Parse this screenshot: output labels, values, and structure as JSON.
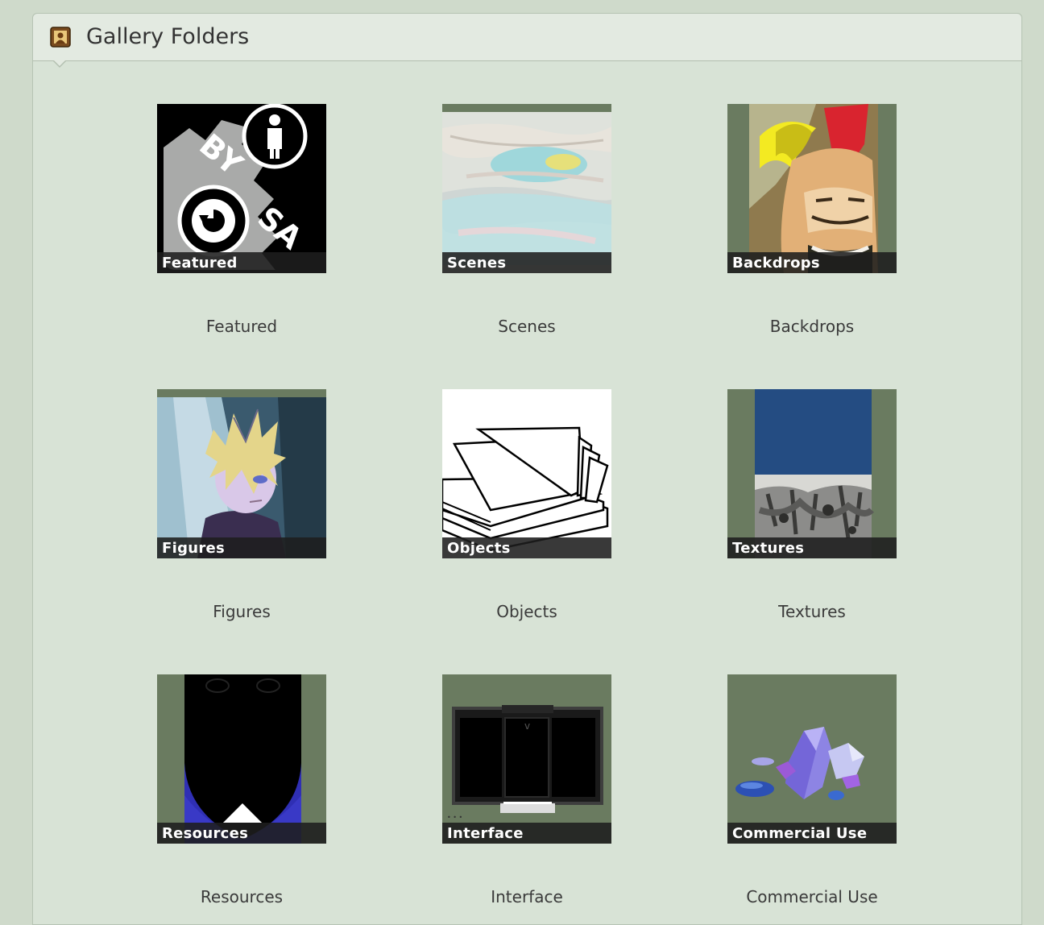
{
  "panel": {
    "title": "Gallery Folders",
    "icon": "portrait-frame-icon"
  },
  "folders": [
    {
      "label": "Featured",
      "caption": "Featured",
      "thumb": "cc-by-sa-icon"
    },
    {
      "label": "Scenes",
      "caption": "Scenes",
      "thumb": "watercolor-sky-image"
    },
    {
      "label": "Backdrops",
      "caption": "Backdrops",
      "thumb": "painted-face-image"
    },
    {
      "label": "Figures",
      "caption": "Figures",
      "thumb": "anime-figure-image"
    },
    {
      "label": "Objects",
      "caption": "Objects",
      "thumb": "open-book-image"
    },
    {
      "label": "Textures",
      "caption": "Textures",
      "thumb": "sky-wall-texture-image"
    },
    {
      "label": "Resources",
      "caption": "Resources",
      "thumb": "dark-silhouette-image"
    },
    {
      "label": "Interface",
      "caption": "Interface",
      "thumb": "dark-panel-image"
    },
    {
      "label": "Commercial Use",
      "caption": "Commercial Use",
      "thumb": "crystals-image"
    }
  ],
  "colors": {
    "page_bg": "#cfdacb",
    "panel_bg": "#d8e3d6",
    "thumb_bg": "#6a7b60",
    "label_bar": "#1e1e1e"
  }
}
